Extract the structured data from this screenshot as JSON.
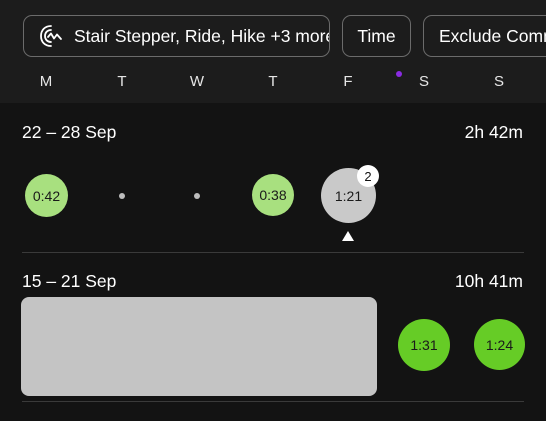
{
  "filters": {
    "activity_label": "Stair Stepper, Ride, Hike +3 more",
    "activity_icon": "activity-rings-icon",
    "time_label": "Time",
    "exclude_label": "Exclude Commutes"
  },
  "weekdays": [
    "M",
    "T",
    "W",
    "T",
    "F",
    "S",
    "S"
  ],
  "colors": {
    "light_green": "#a8e07f",
    "bright_green": "#66cc26",
    "selected_gray": "#c9c9c9",
    "indicator_purple": "#8a2be2"
  },
  "weeks": [
    {
      "range": "22 – 28 Sep",
      "total": "2h 42m",
      "days": [
        {
          "day": "M",
          "value": "0:42",
          "style": "light_green"
        },
        {
          "day": "T",
          "value": null,
          "style": "dot"
        },
        {
          "day": "W",
          "value": null,
          "style": "dot"
        },
        {
          "day": "T",
          "value": "0:38",
          "style": "light_green"
        },
        {
          "day": "F",
          "value": "1:21",
          "style": "selected",
          "badge": "2"
        }
      ]
    },
    {
      "range": "15 – 21 Sep",
      "total": "10h 41m",
      "days": [
        {
          "day": "S",
          "value": "1:31",
          "style": "bright_green"
        },
        {
          "day": "S",
          "value": "1:24",
          "style": "bright_green"
        }
      ]
    }
  ]
}
